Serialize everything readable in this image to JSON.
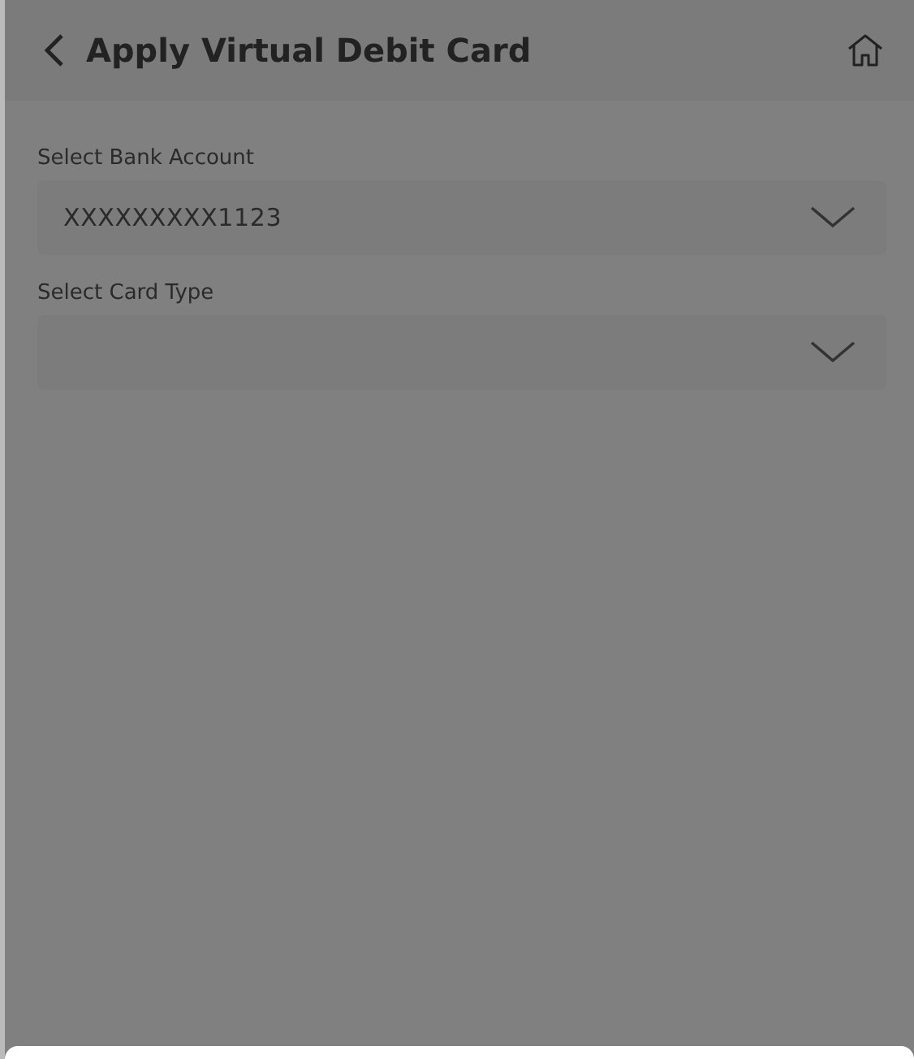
{
  "header": {
    "title": "Apply Virtual Debit Card"
  },
  "fields": [
    {
      "label": "Select Bank Account",
      "value": "XXXXXXXXX1123"
    },
    {
      "label": "Select Card Type"
    }
  ]
}
